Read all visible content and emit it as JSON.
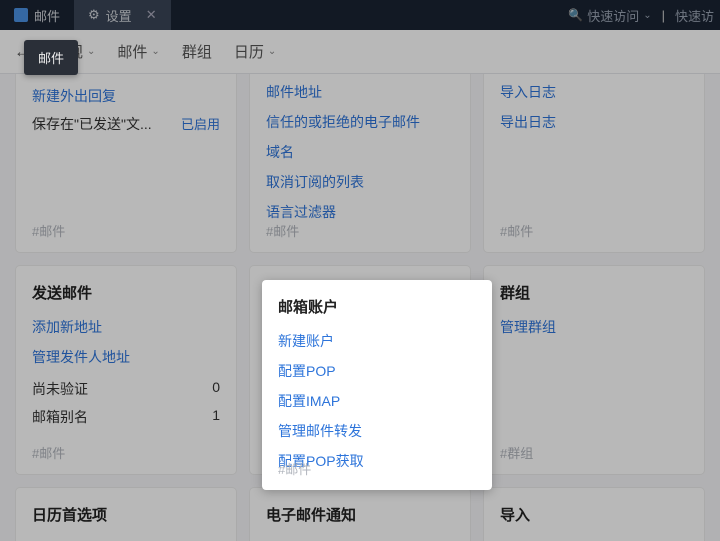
{
  "topbar": {
    "tab1_label": "邮件",
    "tab2_label": "设置",
    "search_label": "快速访问",
    "right_cut": "快速访"
  },
  "tooltip": "邮件",
  "menubar": {
    "item1": "常规",
    "item2": "邮件",
    "item3": "群组",
    "item4": "日历"
  },
  "card_a": {
    "link1": "新建外出回复",
    "row_label": "保存在\"已发送\"文...",
    "row_status": "已启用",
    "tag": "#邮件"
  },
  "card_b": {
    "l1": "邮件地址",
    "l2": "信任的或拒绝的电子邮件",
    "l3": "域名",
    "l4": "取消订阅的列表",
    "l5": "语言过滤器",
    "tag": "#邮件"
  },
  "card_c": {
    "l1": "导入日志",
    "l2": "导出日志",
    "tag": "#邮件"
  },
  "card_d": {
    "title": "发送邮件",
    "l1": "添加新地址",
    "l2": "管理发件人地址",
    "r1_label": "尚未验证",
    "r1_value": "0",
    "r2_label": "邮箱别名",
    "r2_value": "1",
    "tag": "#邮件"
  },
  "card_e": {
    "title": "邮箱账户",
    "l1": "新建账户",
    "l2": "配置POP",
    "l3": "配置IMAP",
    "l4": "管理邮件转发",
    "l5": "配置POP获取",
    "tag": "#邮件"
  },
  "card_f": {
    "title": "群组",
    "l1": "管理群组",
    "tag": "#群组"
  },
  "card_g": {
    "title": "日历首选项"
  },
  "card_h": {
    "title": "电子邮件通知"
  },
  "card_i": {
    "title": "导入"
  }
}
